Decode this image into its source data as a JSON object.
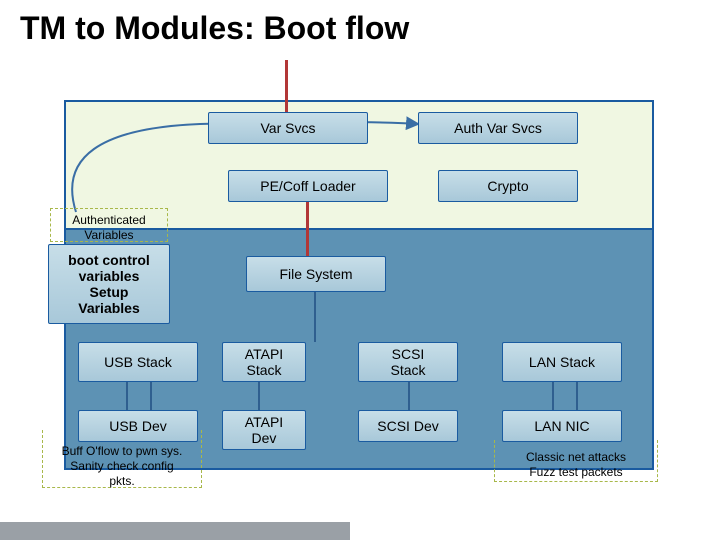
{
  "title": "TM to Modules: Boot flow",
  "modules": {
    "var_svcs": "Var Svcs",
    "auth_var_svcs": "Auth Var Svcs",
    "pe_coff_loader": "PE/Coff Loader",
    "crypto": "Crypto",
    "boot_control": "boot control\nvariables\nSetup\nVariables",
    "file_system": "File System",
    "usb_stack": "USB Stack",
    "atapi_stack": "ATAPI\nStack",
    "scsi_stack": "SCSI\nStack",
    "lan_stack": "LAN Stack",
    "usb_dev": "USB Dev",
    "atapi_dev": "ATAPI\nDev",
    "scsi_dev": "SCSI Dev",
    "lan_nic": "LAN NIC"
  },
  "annotations": {
    "authenticated_variables": "Authenticated\nVariables",
    "usb_note": "Buff O'flow to pwn sys.\nSanity check config\npkts.",
    "lan_note": "Classic net attacks\nFuzz test packets"
  }
}
